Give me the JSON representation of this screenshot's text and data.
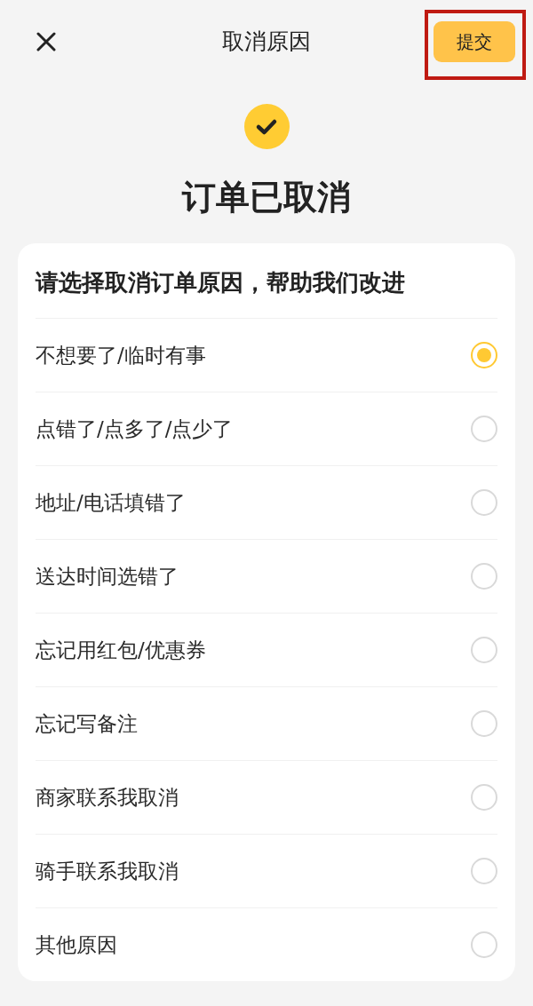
{
  "header": {
    "title": "取消原因",
    "submit": {
      "label": "提交",
      "highlighted": true
    }
  },
  "status": {
    "title": "订单已取消"
  },
  "reasons_card": {
    "title": "请选择取消订单原因，帮助我们改进",
    "options": [
      {
        "label": "不想要了/临时有事",
        "selected": true
      },
      {
        "label": "点错了/点多了/点少了",
        "selected": false
      },
      {
        "label": "地址/电话填错了",
        "selected": false
      },
      {
        "label": "送达时间选错了",
        "selected": false
      },
      {
        "label": "忘记用红包/优惠券",
        "selected": false
      },
      {
        "label": "忘记写备注",
        "selected": false
      },
      {
        "label": "商家联系我取消",
        "selected": false
      },
      {
        "label": "骑手联系我取消",
        "selected": false
      },
      {
        "label": "其他原因",
        "selected": false
      }
    ]
  }
}
